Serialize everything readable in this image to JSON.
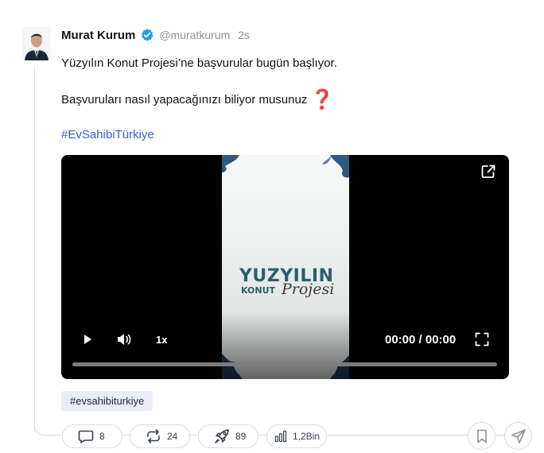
{
  "post": {
    "author_name": "Murat Kurum",
    "handle": "@muratkurum",
    "time": "2s",
    "text_line1": "Yüzyılın Konut Projesi’ne başvurular bugün başlıyor.",
    "text_line2": "Başvuruları nasıl yapacağınızı biliyor musunuz",
    "hashtag_link": "#EvSahibiTürkiye"
  },
  "video": {
    "thumbnail_text": {
      "line1": "YUZYILIN",
      "line2": "KONUT",
      "line3": "Projesi"
    },
    "speed": "1x",
    "timecode": "00:00 / 00:00",
    "progress": 0
  },
  "tag": "#evsahibiturkiye",
  "actions": {
    "replies": "8",
    "reposts": "24",
    "boosts": "89",
    "views": "1,2Bin"
  },
  "colors": {
    "verified": "#1d9bf0",
    "hashtag": "#3d5bd6",
    "question_mark": "#c31c2c"
  }
}
